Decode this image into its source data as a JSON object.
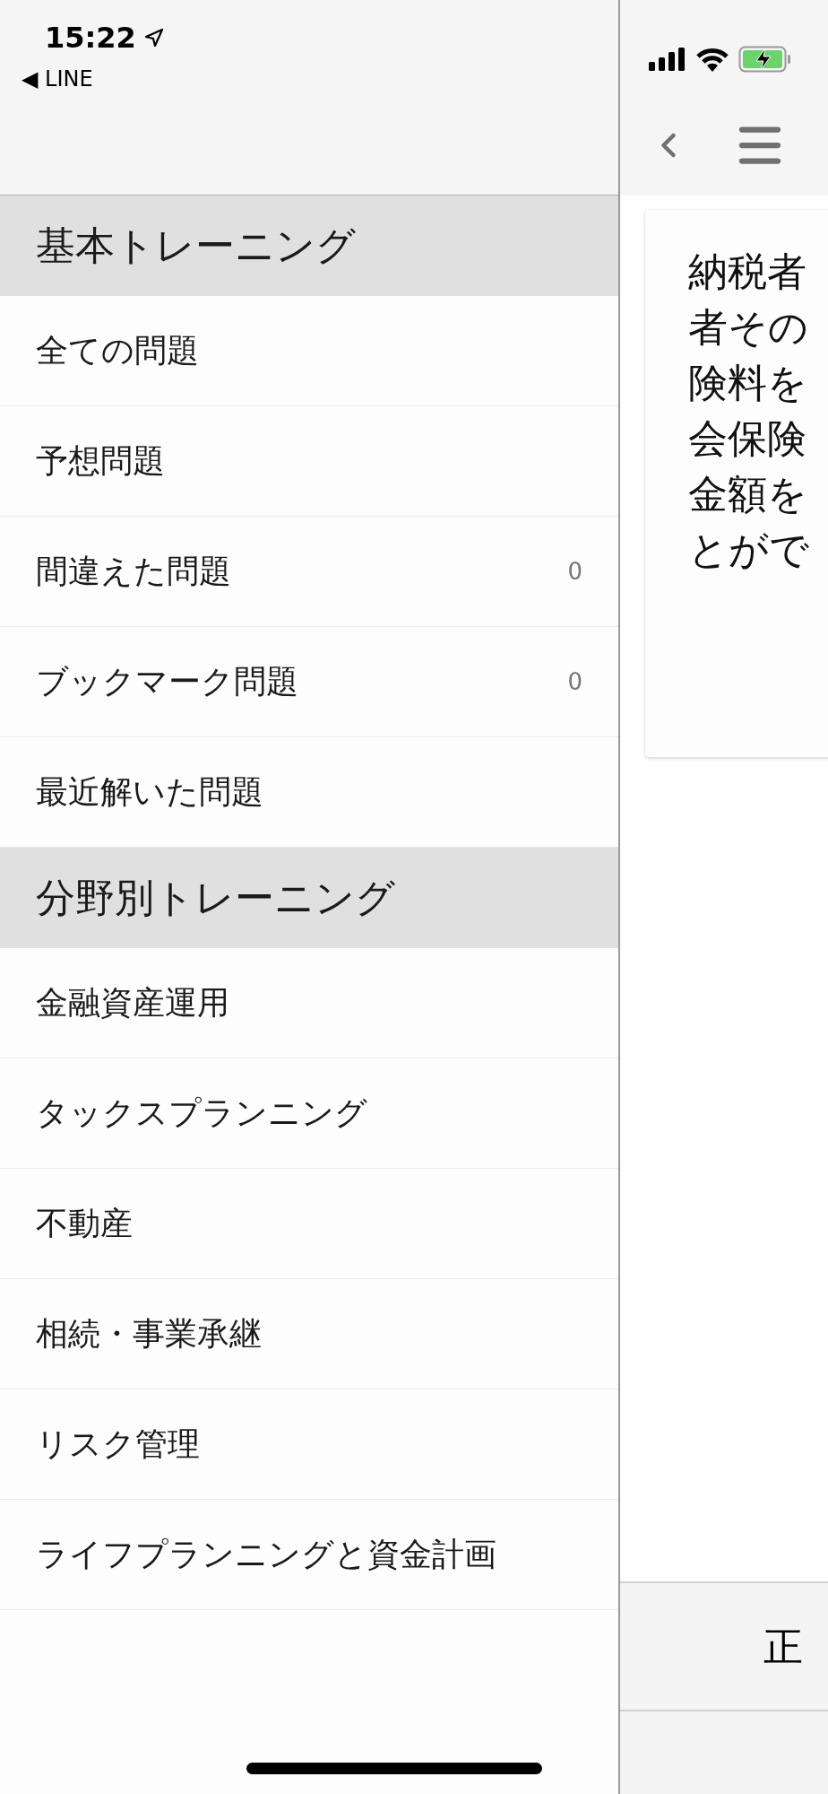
{
  "status_bar": {
    "time": "15:22",
    "back_app": "◀ LINE"
  },
  "sections": [
    {
      "title": "基本トレーニング",
      "items": [
        {
          "label": "全ての問題"
        },
        {
          "label": "予想問題"
        },
        {
          "label": "間違えた問題",
          "count": "0"
        },
        {
          "label": "ブックマーク問題",
          "count": "0"
        },
        {
          "label": "最近解いた問題"
        }
      ]
    },
    {
      "title": "分野別トレーニング",
      "items": [
        {
          "label": "金融資産運用"
        },
        {
          "label": "タックスプランニング"
        },
        {
          "label": "不動産"
        },
        {
          "label": "相続・事業承継"
        },
        {
          "label": "リスク管理"
        },
        {
          "label": "ライフプランニングと資金計画"
        }
      ]
    }
  ],
  "question": {
    "lines": [
      "納税者",
      "者その",
      "険料を",
      "会保険",
      "金額を",
      "とがで"
    ]
  },
  "answer_button": "正"
}
